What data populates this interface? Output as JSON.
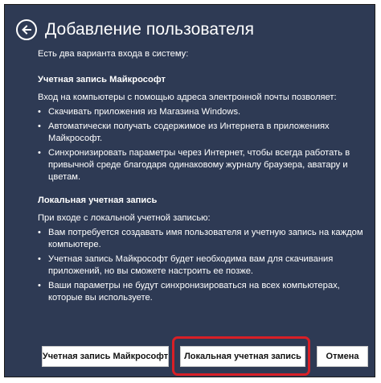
{
  "header": {
    "title": "Добавление пользователя",
    "back_icon": "arrow-left-icon"
  },
  "intro": "Есть два варианта входа в систему:",
  "microsoft_section": {
    "title": "Учетная запись Майкрософт",
    "intro": "Вход на компьютеры с помощью адреса электронной почты позволяет:",
    "bullets": [
      "Скачивать приложения из Магазина Windows.",
      "Автоматически получать содержимое из Интернета в приложениях Майкрософт.",
      "Синхронизировать параметры через Интернет, чтобы всегда работать в привычной среде благодаря одинаковому журналу браузера, аватару и цветам."
    ]
  },
  "local_section": {
    "title": "Локальная учетная запись",
    "intro": "При входе с локальной учетной записью:",
    "bullets": [
      "Вам потребуется создавать имя пользователя и учетную запись на каждом компьютере.",
      "Учетная запись Майкрософт будет необходима вам для скачивания приложений, но вы сможете настроить ее позже.",
      "Ваши параметры не будут синхронизироваться на всех компьютерах, которые вы используете."
    ]
  },
  "buttons": {
    "microsoft": "Учетная запись Майкрософт",
    "local": "Локальная учетная запись",
    "cancel": "Отмена"
  },
  "colors": {
    "background": "#2e3a54",
    "highlight": "#d81f26"
  }
}
